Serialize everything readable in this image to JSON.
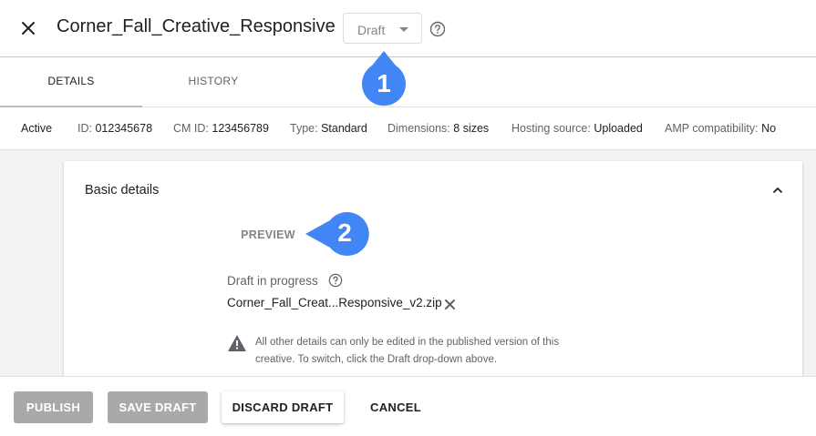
{
  "header": {
    "title": "Corner_Fall_Creative_Responsive",
    "status_dropdown": "Draft",
    "icons": [
      "close-icon",
      "help-icon",
      "chevron-down-icon"
    ]
  },
  "tabs": [
    {
      "label": "DETAILS"
    },
    {
      "label": "HISTORY"
    }
  ],
  "info": {
    "status": "Active",
    "id_label": "ID:",
    "id_value": "012345678",
    "cm_id_label": "CM ID:",
    "cm_id_value": "123456789",
    "type_label": "Type:",
    "type_value": "Standard",
    "dimensions_label": "Dimensions:",
    "dimensions_value": "8 sizes",
    "hosting_label": "Hosting source:",
    "hosting_value": "Uploaded",
    "amp_label": "AMP compatibility:",
    "amp_value": "No"
  },
  "card": {
    "title": "Basic details",
    "preview_label": "PREVIEW",
    "draft_label": "Draft in progress",
    "filename": "Corner_Fall_Creat...Responsive_v2.zip",
    "warning_text": "All other details can only be edited in the published version of this creative. To switch, click the Draft drop-down above."
  },
  "footer": {
    "publish": "PUBLISH",
    "save_draft": "SAVE DRAFT",
    "discard_draft": "DISCARD DRAFT",
    "cancel": "CANCEL"
  },
  "callouts": [
    {
      "number": "1"
    },
    {
      "number": "2"
    }
  ],
  "colors": {
    "callout_blue": "#4285f4",
    "disabled_button": "#a9a9a9",
    "background": "#f1f3f4"
  }
}
